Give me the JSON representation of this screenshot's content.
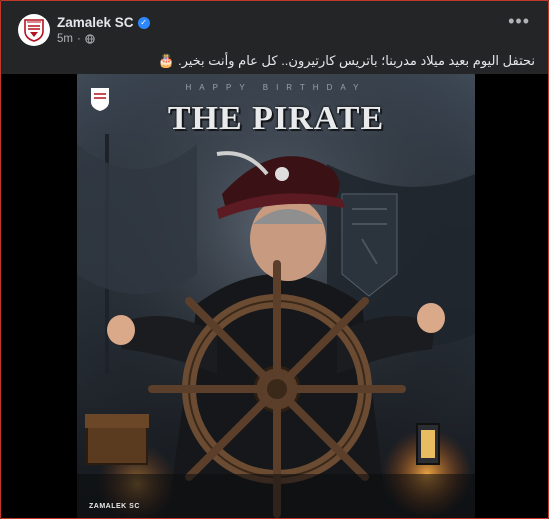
{
  "post": {
    "page_name": "Zamalek SC",
    "time": "5m",
    "dot": "·",
    "caption": "نحتفل اليوم بعيد ميلاد مدربنا؛ باتريس كارتيرون.. كل عام وأنت بخير. 🎂",
    "more_label": "•••"
  },
  "poster": {
    "subtitle": "HAPPY BIRTHDAY",
    "title": "THE PIRATE",
    "brand": "ZAMALEK SC"
  },
  "colors": {
    "background": "#242526",
    "border": "#c0392b",
    "text": "#e4e6eb",
    "muted": "#b0b3b8",
    "verified": "#2d88ff"
  },
  "icons": {
    "verified": "verified-badge-icon",
    "globe": "globe-icon",
    "more": "more-options-icon"
  }
}
